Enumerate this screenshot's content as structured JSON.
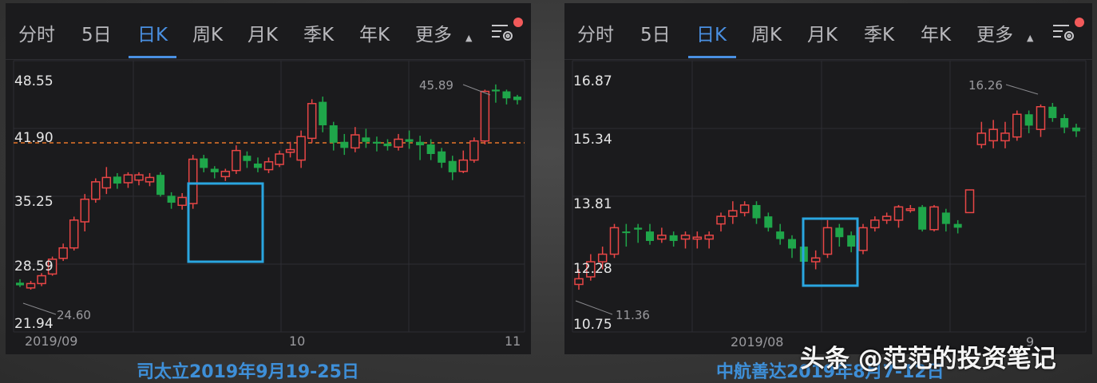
{
  "tabs": [
    "分时",
    "5日",
    "日K",
    "周K",
    "月K",
    "季K",
    "年K",
    "更多"
  ],
  "active_tab": "日K",
  "icons": {
    "settings": "settings-gear-icon",
    "notification": "red-dot-badge",
    "more_caret": "caret-down-icon"
  },
  "colors": {
    "up": "#e84646",
    "down": "#1fa64a",
    "highlight_box": "#2aa6e0",
    "dashed_line": "#e8762a",
    "active_tab": "#4a90e2"
  },
  "left": {
    "caption": "司太立2019年9月19-25日",
    "y_ticks": [
      "48.55",
      "41.90",
      "35.25",
      "28.59",
      "21.94"
    ],
    "x_ticks": [
      "2019/09",
      "10",
      "11"
    ],
    "high_label": "45.89",
    "low_label": "24.60"
  },
  "right": {
    "caption": "中航善达2019年8月7-12日",
    "y_ticks": [
      "16.87",
      "15.34",
      "13.81",
      "12.28",
      "10.75"
    ],
    "x_ticks": [
      "2019/08",
      "9"
    ],
    "high_label": "16.26",
    "low_label": "11.36"
  },
  "watermark": "头条 @范范的投资笔记",
  "chart_data": [
    {
      "type": "candlestick",
      "title": "司太立",
      "ylim": [
        21.94,
        48.55
      ],
      "y_ticks": [
        48.55,
        41.9,
        35.25,
        28.59,
        21.94
      ],
      "x_ticks": [
        "2019/09",
        "10",
        "11"
      ],
      "reference_line": 41.9,
      "max_marker": 45.89,
      "min_marker": 24.6,
      "highlight_range": "9/19-9/25",
      "candles": [
        [
          25.4,
          25.1,
          25.8,
          24.9
        ],
        [
          24.8,
          25.3,
          25.6,
          24.6
        ],
        [
          25.3,
          26.2,
          26.5,
          25.0
        ],
        [
          26.4,
          28.1,
          28.4,
          26.2
        ],
        [
          28.2,
          29.4,
          29.9,
          27.9
        ],
        [
          29.4,
          32.6,
          33.0,
          29.1
        ],
        [
          32.4,
          35.0,
          35.6,
          31.3
        ],
        [
          35.0,
          37.0,
          37.4,
          34.6
        ],
        [
          36.3,
          37.5,
          38.7,
          35.6
        ],
        [
          37.6,
          36.8,
          38.0,
          36.2
        ],
        [
          36.9,
          37.8,
          38.1,
          36.3
        ],
        [
          37.2,
          37.8,
          38.1,
          36.6
        ],
        [
          37.0,
          37.5,
          38.0,
          36.5
        ],
        [
          37.8,
          35.5,
          38.1,
          35.3
        ],
        [
          35.4,
          34.6,
          35.8,
          33.9
        ],
        [
          34.3,
          35.2,
          35.7,
          33.8
        ],
        [
          34.5,
          39.6,
          40.1,
          33.9
        ],
        [
          39.7,
          38.6,
          40.1,
          38.1
        ],
        [
          38.5,
          38.1,
          38.8,
          37.4
        ],
        [
          37.6,
          38.2,
          38.5,
          37.1
        ],
        [
          38.3,
          40.6,
          41.2,
          37.9
        ],
        [
          40.0,
          39.4,
          40.5,
          38.6
        ],
        [
          39.1,
          38.6,
          39.8,
          38.1
        ],
        [
          38.4,
          39.3,
          39.8,
          38.0
        ],
        [
          39.0,
          40.2,
          40.6,
          38.7
        ],
        [
          40.4,
          40.7,
          41.6,
          39.8
        ],
        [
          39.5,
          42.2,
          42.9,
          38.6
        ],
        [
          42.0,
          46.0,
          46.5,
          41.5
        ],
        [
          46.2,
          43.5,
          46.8,
          42.7
        ],
        [
          43.5,
          41.5,
          43.9,
          40.6
        ],
        [
          41.6,
          40.9,
          42.5,
          40.1
        ],
        [
          40.9,
          42.4,
          43.3,
          40.4
        ],
        [
          42.1,
          41.6,
          43.1,
          40.9
        ],
        [
          41.6,
          41.4,
          42.2,
          40.5
        ],
        [
          41.4,
          41.1,
          41.9,
          40.6
        ],
        [
          41.0,
          41.9,
          42.5,
          40.6
        ],
        [
          41.9,
          41.6,
          42.9,
          40.8
        ],
        [
          41.6,
          41.2,
          42.3,
          39.5
        ],
        [
          41.3,
          40.2,
          41.9,
          39.5
        ],
        [
          40.5,
          39.2,
          40.9,
          38.6
        ],
        [
          39.4,
          38.1,
          40.0,
          37.2
        ],
        [
          38.2,
          39.5,
          40.6,
          38.0
        ],
        [
          39.5,
          41.7,
          42.1,
          39.2
        ],
        [
          41.7,
          47.4,
          47.6,
          41.3
        ],
        [
          47.6,
          47.4,
          48.2,
          46.1
        ],
        [
          47.4,
          46.6,
          47.6,
          45.9
        ],
        [
          46.8,
          46.4,
          47.0,
          45.9
        ]
      ]
    },
    {
      "type": "candlestick",
      "title": "中航善达",
      "ylim": [
        10.75,
        16.87
      ],
      "y_ticks": [
        16.87,
        15.34,
        13.81,
        12.28,
        10.75
      ],
      "x_ticks": [
        "2019/08",
        "9"
      ],
      "max_marker": 16.26,
      "min_marker": 11.36,
      "highlight_range": "8/7-8/12",
      "candles": [
        [
          11.5,
          11.65,
          11.9,
          11.36
        ],
        [
          11.7,
          12.1,
          12.3,
          11.6
        ],
        [
          12.1,
          12.3,
          12.5,
          11.9
        ],
        [
          12.3,
          13.0,
          13.1,
          12.2
        ],
        [
          12.9,
          12.88,
          13.1,
          12.5
        ],
        [
          13.0,
          12.95,
          13.1,
          12.6
        ],
        [
          12.9,
          12.65,
          13.1,
          12.55
        ],
        [
          12.7,
          12.8,
          13.0,
          12.6
        ],
        [
          12.8,
          12.65,
          12.9,
          12.5
        ],
        [
          12.7,
          12.8,
          12.9,
          12.45
        ],
        [
          12.7,
          12.75,
          12.9,
          12.45
        ],
        [
          12.7,
          12.8,
          12.9,
          12.45
        ],
        [
          13.1,
          13.3,
          13.4,
          12.9
        ],
        [
          13.3,
          13.45,
          13.7,
          13.1
        ],
        [
          13.4,
          13.6,
          13.7,
          13.3
        ],
        [
          13.6,
          13.25,
          13.7,
          13.1
        ],
        [
          13.3,
          13.0,
          13.4,
          12.9
        ],
        [
          12.9,
          12.7,
          13.1,
          12.55
        ],
        [
          12.7,
          12.45,
          12.8,
          12.2
        ],
        [
          12.5,
          12.1,
          12.6,
          12.0
        ],
        [
          12.1,
          12.2,
          12.4,
          11.9
        ],
        [
          12.3,
          13.0,
          13.2,
          12.2
        ],
        [
          13.0,
          12.75,
          13.1,
          12.5
        ],
        [
          12.8,
          12.5,
          12.9,
          12.35
        ],
        [
          12.4,
          13.0,
          13.1,
          12.3
        ],
        [
          13.0,
          13.2,
          13.3,
          12.9
        ],
        [
          13.2,
          13.3,
          13.4,
          13.1
        ],
        [
          13.2,
          13.55,
          13.6,
          13.0
        ],
        [
          13.5,
          13.5,
          13.6,
          13.4
        ],
        [
          13.55,
          12.95,
          13.6,
          12.9
        ],
        [
          12.95,
          13.55,
          13.6,
          12.9
        ],
        [
          13.4,
          13.1,
          13.5,
          12.9
        ],
        [
          13.1,
          13.0,
          13.2,
          12.85
        ],
        [
          13.4,
          14.0,
          14.0,
          13.4
        ],
        [
          15.2,
          15.5,
          15.8,
          15.1
        ],
        [
          15.3,
          15.6,
          15.85,
          15.1
        ],
        [
          15.3,
          15.5,
          15.8,
          15.1
        ],
        [
          15.4,
          16.0,
          16.1,
          15.3
        ],
        [
          16.0,
          15.7,
          16.1,
          15.5
        ],
        [
          15.6,
          16.2,
          16.26,
          15.4
        ],
        [
          16.2,
          15.9,
          16.3,
          15.8
        ],
        [
          15.9,
          15.65,
          16.0,
          15.5
        ],
        [
          15.65,
          15.55,
          15.75,
          15.4
        ]
      ]
    }
  ]
}
